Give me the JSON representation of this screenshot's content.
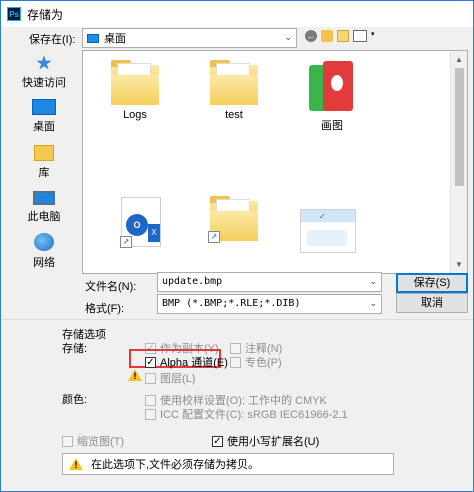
{
  "window": {
    "title": "存储为",
    "app_icon": "Ps"
  },
  "lookin": {
    "label": "保存在(I):",
    "value": "桌面"
  },
  "nav_icons": [
    "back-icon",
    "up-folder-icon",
    "new-folder-icon",
    "view-menu-icon"
  ],
  "places": [
    {
      "id": "quick-access",
      "label": "快速访问",
      "icon": "star-icon"
    },
    {
      "id": "desktop",
      "label": "桌面",
      "icon": "desktop-icon"
    },
    {
      "id": "library",
      "label": "库",
      "icon": "library-icon"
    },
    {
      "id": "this-pc",
      "label": "此电脑",
      "icon": "computer-icon"
    },
    {
      "id": "network",
      "label": "网络",
      "icon": "network-icon"
    }
  ],
  "files": [
    {
      "label": "Logs",
      "type": "folder"
    },
    {
      "label": "test",
      "type": "folder"
    },
    {
      "label": "画图",
      "type": "app-shortcut"
    },
    {
      "label": "",
      "type": "document-shortcut"
    },
    {
      "label": "",
      "type": "folder-shortcut"
    },
    {
      "label": "",
      "type": "image"
    }
  ],
  "filename": {
    "label": "文件名(N):",
    "value": "update.bmp"
  },
  "format": {
    "label": "格式(F):",
    "value": "BMP (*.BMP;*.RLE;*.DIB)"
  },
  "buttons": {
    "save": "保存(S)",
    "cancel": "取消"
  },
  "save_options": {
    "title": "存储选项",
    "store_label": "存储:",
    "as_copy": {
      "label": "作为副本(Y)",
      "checked": true,
      "enabled": false
    },
    "notes": {
      "label": "注释(N)",
      "checked": false,
      "enabled": false
    },
    "alpha": {
      "label": "Alpha 通道(E)",
      "checked": true,
      "enabled": true
    },
    "spot": {
      "label": "专色(P)",
      "checked": false,
      "enabled": false
    },
    "layers": {
      "label": "图层(L)",
      "checked": false,
      "enabled": false
    }
  },
  "color": {
    "label": "颜色:",
    "proof": {
      "label": "使用校样设置(O): 工作中的 CMYK",
      "checked": false,
      "enabled": false
    },
    "icc": {
      "label": "ICC 配置文件(C): sRGB IEC61966-2.1",
      "checked": false,
      "enabled": false
    }
  },
  "thumbnail": {
    "label": "缩览图(T)",
    "checked": false,
    "enabled": false
  },
  "lowercase_ext": {
    "label": "使用小写扩展名(U)",
    "checked": true,
    "enabled": true
  },
  "warning_text": "在此选项下,文件必须存储为拷贝。"
}
